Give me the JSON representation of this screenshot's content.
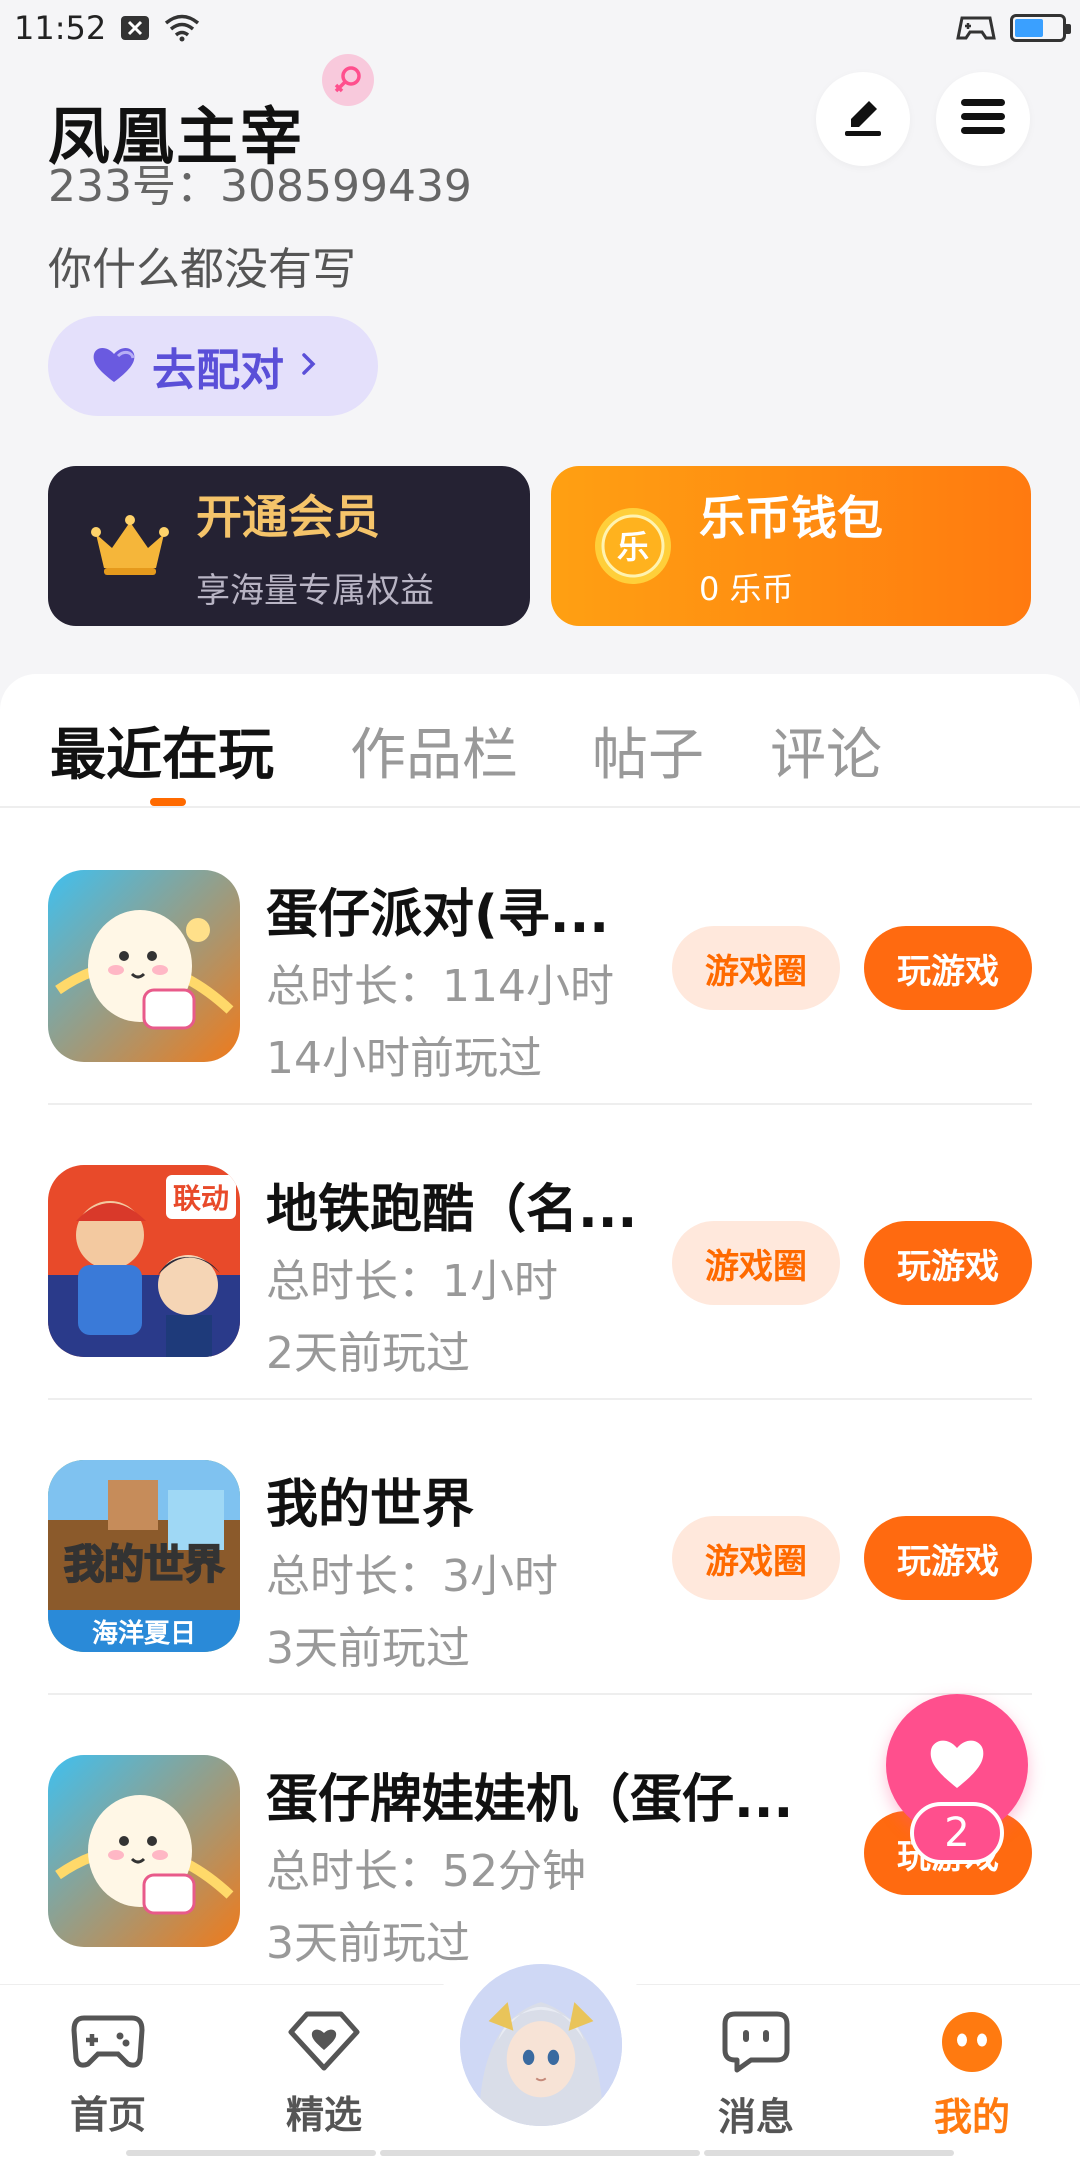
{
  "status_bar": {
    "time": "11:52"
  },
  "profile": {
    "name": "凤凰主宰",
    "id_text": "233号：308599439",
    "bio": "你什么都没有写",
    "match_label": "去配对"
  },
  "cards": {
    "vip": {
      "title": "开通会员",
      "subtitle": "享海量专属权益"
    },
    "wallet": {
      "title": "乐币钱包",
      "subtitle": "0 乐币",
      "coin_glyph": "乐"
    }
  },
  "tabs": [
    {
      "label": "最近在玩"
    },
    {
      "label": "作品栏"
    },
    {
      "label": "帖子"
    },
    {
      "label": "评论"
    }
  ],
  "games": [
    {
      "title": "蛋仔派对(寻...",
      "duration": "总时长：114小时",
      "last_played": "14小时前玩过",
      "circle_label": "游戏圈",
      "play_label": "玩游戏"
    },
    {
      "title": "地铁跑酷（名...",
      "duration": "总时长：1小时",
      "last_played": "2天前玩过",
      "circle_label": "游戏圈",
      "play_label": "玩游戏"
    },
    {
      "title": "我的世界",
      "duration": "总时长：3小时",
      "last_played": "3天前玩过",
      "circle_label": "游戏圈",
      "play_label": "玩游戏"
    },
    {
      "title": "蛋仔牌娃娃机（蛋仔...",
      "duration": "总时长：52分钟",
      "last_played": "3天前玩过",
      "play_label": "玩游戏"
    }
  ],
  "game_icon_text": {
    "subway_badge": "联动",
    "minecraft_title": "我的世界",
    "minecraft_sub": "海洋夏日"
  },
  "floating": {
    "count": "2"
  },
  "nav": [
    {
      "label": "首页"
    },
    {
      "label": "精选"
    },
    {
      "label": "消息"
    },
    {
      "label": "我的"
    }
  ],
  "colors": {
    "accent": "#ff6a10",
    "wallet_gradient": [
      "#ffa012",
      "#ff7a10"
    ],
    "vip_bg": "#252233",
    "match_bg": "#e4e0fb",
    "heart_pink": "#ff4f8d"
  },
  "icons": [
    "close-box-icon",
    "wifi-icon",
    "gamepad-status-icon",
    "battery-icon",
    "female-icon",
    "edit-icon",
    "menu-icon",
    "heart-icon",
    "chevron-right-icon",
    "crown-icon",
    "coin-icon",
    "gamepad-icon",
    "heart-diamond-icon",
    "chat-icon",
    "dots-face-icon"
  ]
}
